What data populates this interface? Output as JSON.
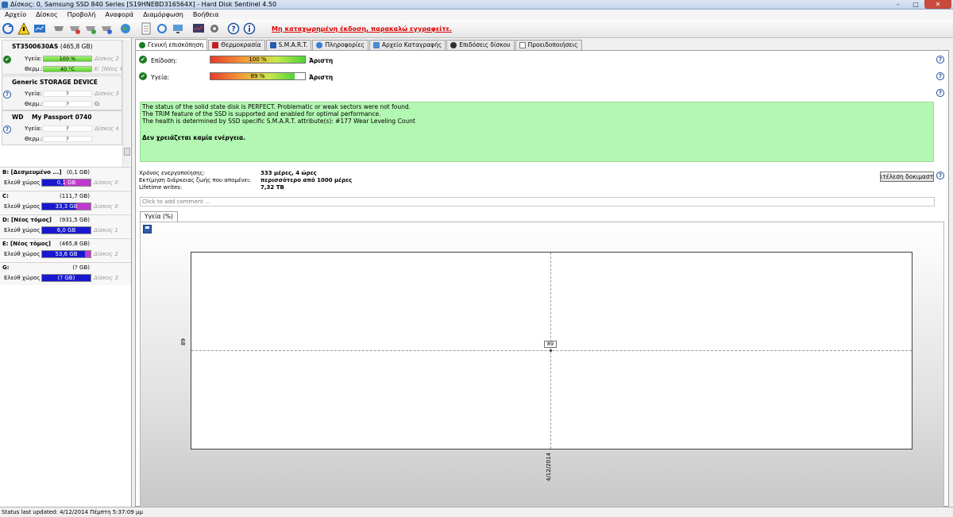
{
  "window": {
    "title": "Δίσκος: 0, Samsung SSD 840 Series [S19HNEBD316564X] - Hard Disk Sentinel 4.50",
    "minimize": "–",
    "maximize": "□",
    "close": "✕"
  },
  "menu": [
    "Αρχείο",
    "Δίσκος",
    "Προβολή",
    "Αναφορά",
    "Διαμόρφωση",
    "Βοήθεια"
  ],
  "toolbar": {
    "register_notice": "Μη καταχωρημένη έκδοση, παρακαλώ εγγραφείτε.",
    "icons": [
      "refresh-icon",
      "warning-icon",
      "report-icon",
      "disk-icon",
      "disk-test-icon",
      "disk-clean-icon",
      "disk-repair-icon",
      "globe-icon",
      "document-icon",
      "sync-icon",
      "network-icon",
      "chart-icon",
      "gear-icon",
      "help-icon",
      "info-icon"
    ]
  },
  "disks": [
    {
      "name": "ST3500630AS",
      "size": "(465,8 GB)",
      "health_label": "Υγεία:",
      "health_value": "100 %",
      "temp_label": "Θερμ.:",
      "temp_value": "40 °C",
      "hint1": "Δίσκος 2",
      "hint2": "E: [Νέος τό"
    },
    {
      "name": "Generic STORAGE DEVICE",
      "size": "",
      "health_label": "Υγεία:",
      "health_value": "?",
      "temp_label": "Θερμ.:",
      "temp_value": "?",
      "hint1": "Δίσκος 3",
      "hint2": "G:"
    },
    {
      "name": "WD    My Passport 0740",
      "size": "",
      "health_label": "Υγεία:",
      "health_value": "?",
      "temp_label": "Θερμ.:",
      "temp_value": "?",
      "hint1": "Δίσκος 4",
      "hint2": ""
    }
  ],
  "volumes": [
    {
      "name": "B: [Δεσμευμένο ...]",
      "size": "(0,1 GB)",
      "free_label": "Ελεύθ χώρος",
      "free": "0,1 GB",
      "disk": "Δίσκος 0",
      "fill": 0.45,
      "magenta": 0.55
    },
    {
      "name": "C:",
      "size": "(111,7 GB)",
      "free_label": "Ελεύθ χώρος",
      "free": "33,3 GB",
      "disk": "Δίσκος 0",
      "fill": 0.7,
      "magenta": 0.3
    },
    {
      "name": "D: [Νέος τόμος]",
      "size": "(931,5 GB)",
      "free_label": "Ελεύθ χώρος",
      "free": "6,0 GB",
      "disk": "Δίσκος 1",
      "fill": 1.0,
      "magenta": 0.0
    },
    {
      "name": "E: [Νέος τόμος]",
      "size": "(465,8 GB)",
      "free_label": "Ελεύθ χώρος",
      "free": "53,6 GB",
      "disk": "Δίσκος 2",
      "fill": 0.88,
      "magenta": 0.12
    },
    {
      "name": "G:",
      "size": "(? GB)",
      "free_label": "Ελεύθ χώρος",
      "free": "(? GB)",
      "disk": "Δίσκος 3",
      "fill": 1.0,
      "magenta": 0.0
    }
  ],
  "tabs": [
    "Γενική επισκόπηση",
    "Θερμοκρασία",
    "S.M.A.R.T.",
    "Πληροφορίες",
    "Αρχείο Καταγραφής",
    "Επιδόσεις δίσκου",
    "Προειδοποιήσεις"
  ],
  "overview": {
    "performance_label": "Επίδοση:",
    "performance_value": "100 %",
    "performance_pct": 100,
    "performance_verdict": "Άριστη",
    "health_label": "Υγεία:",
    "health_value": "89 %",
    "health_pct": 89,
    "health_verdict": "Άριστη",
    "status_lines": [
      "The status of the solid state disk is PERFECT. Problematic or weak sectors were not found.",
      "The TRIM feature of the SSD is supported and enabled for optimal performance.",
      "The health is determined by SSD specific S.M.A.R.T. attribute(s):  #177 Wear Leveling Count"
    ],
    "advice": "Δεν χρειάζεται καμία ενέργεια.",
    "power_on_label": "Χρόνος ενεργοποίησης:",
    "power_on_value": "333 μέρες, 4 ώρες",
    "lifetime_est_label": "Εκτίμηση διάρκειας ζωής που απομένει:",
    "lifetime_est_value": "περισσότερο από 1000 μέρες",
    "writes_label": "Lifetime writes:",
    "writes_value": "7,32 TB",
    "test_button": "Εκτέλεση δοκιμαστικού",
    "comment_placeholder": "Click to add comment ..."
  },
  "chart_tab": "Υγεία (%)",
  "chart_data": {
    "type": "line",
    "x": [
      "4/12/2014"
    ],
    "series": [
      {
        "values": [
          89
        ]
      }
    ],
    "data_labels": [
      "89"
    ],
    "ytick": "89",
    "grid": true
  },
  "statusbar": "Status last updated: 4/12/2014 Πέμπτη 5:37:09 μμ"
}
